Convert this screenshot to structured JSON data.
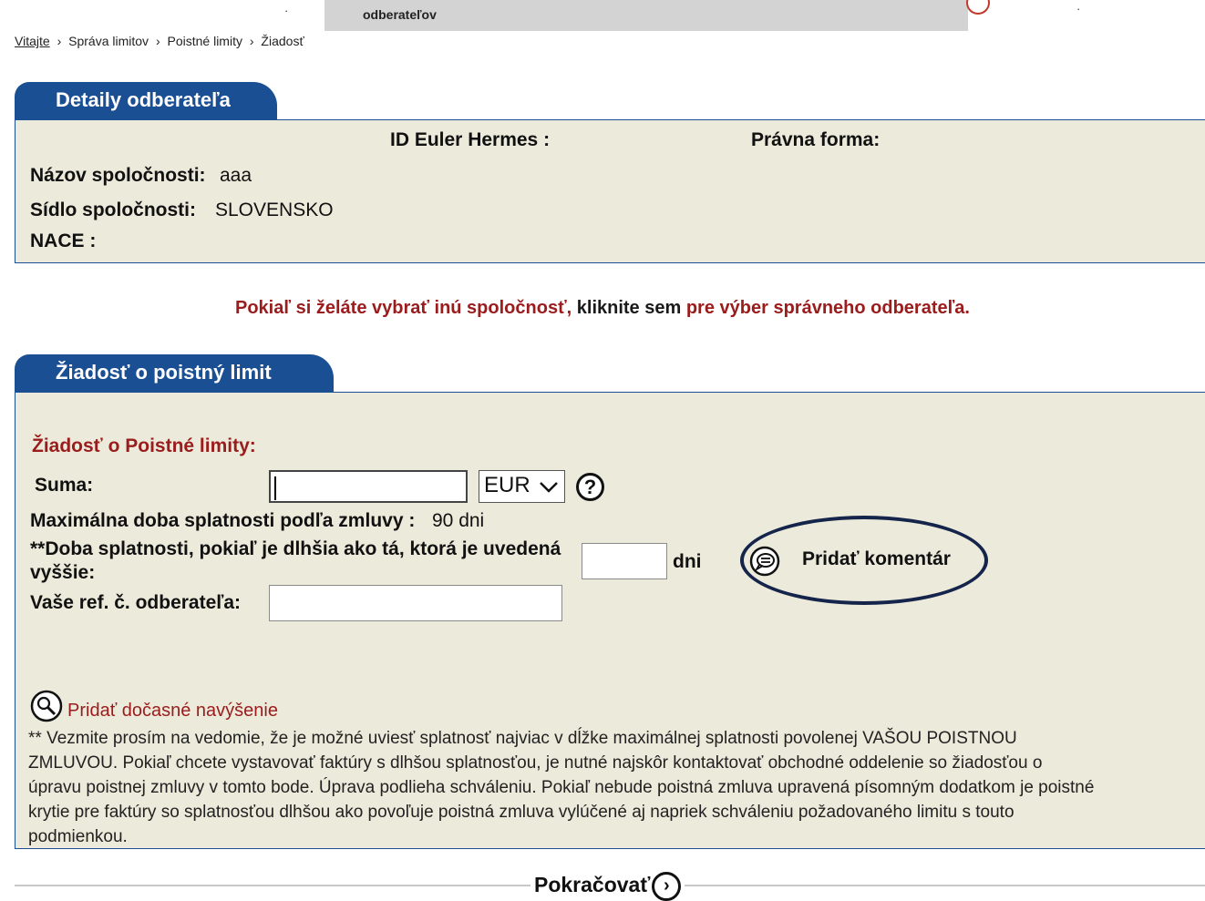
{
  "top_nav": {
    "partial_text": "odberateľov",
    "tick_left": "·",
    "tick_right": "·"
  },
  "breadcrumb": {
    "home": "Vitajte",
    "separator": "›",
    "items": [
      "Správa limitov",
      "Poistné limity",
      "Žiadosť"
    ]
  },
  "customer_details": {
    "tab_title": "Detaily odberateľa",
    "id_label": "ID Euler Hermes :",
    "legal_form_label": "Právna forma:",
    "company_name_label": "Názov spoločnosti:",
    "company_name_value": "aaa",
    "seat_label": "Sídlo spoločnosti:",
    "seat_value": "SLOVENSKO",
    "nace_label": "NACE :"
  },
  "select_company_note": {
    "prefix": "Pokiaľ si želáte vybrať inú spoločnosť, ",
    "link": "kliknite sem",
    "suffix": " pre výber správneho odberateľa."
  },
  "request": {
    "tab_title": "Žiadosť o poistný limit",
    "form_title": "Žiadosť o Poistné limity:",
    "amount_label": "Suma:",
    "amount_value": "",
    "currency_selected": "EUR",
    "max_term_label": "Maximálna doba splatnosti podľa zmluvy :",
    "max_term_value": "90 dni",
    "term_label_line1": "**Doba splatnosti, pokiaľ je dlhšia ako tá, ktorá je uvedená",
    "term_label_line2": "vyššie:",
    "term_value": "",
    "term_unit": "dni",
    "ref_label": "Vaše ref. č. odberateľa:",
    "ref_value": "",
    "add_comment": "Pridať komentár",
    "temp_increase_link": "Pridať dočasné navýšenie",
    "note": "** Vezmite prosím na vedomie, že je možné uviesť splatnosť najviac v dĺžke maximálnej splatnosti povolenej VAŠOU POISTNOU\nZMLUVOU. Pokiaľ chcete vystavovať faktúry s dlhšou splatnosťou, je nutné najskôr kontaktovať obchodné oddelenie so žiadosťou o\núpravu poistnej zmluvy v tomto bode. Úprava podlieha schváleniu. Pokiaľ nebude poistná zmluva upravená písomným dodatkom je poistné\nkrytie pre faktúry so splatnosťou dlhšou ako povoľuje poistná zmluva vylúčené aj napriek schváleniu požadovaného limitu s touto\npodmienkou."
  },
  "continue_label": "Pokračovať",
  "icons": {
    "help": "?",
    "continue": "›",
    "currency_chevron": "⌄"
  },
  "colors": {
    "tab_blue": "#1a4f94",
    "panel_bg": "#eceadb",
    "dark_red": "#9a1c1c",
    "annotation_ellipse": "#14244a"
  }
}
